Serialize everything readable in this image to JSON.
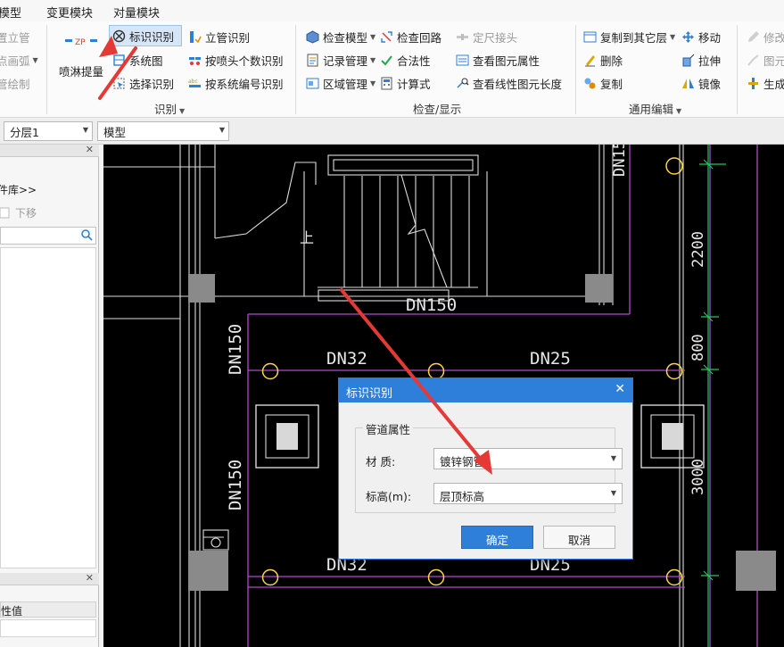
{
  "menubar": {
    "items": [
      "模型",
      "变更模块",
      "对量模块"
    ]
  },
  "ribbon": {
    "left_partial": [
      "置立管",
      "点画弧",
      "管绘制"
    ],
    "sprinkler_button": "喷淋提量",
    "sprinkler_icon_text": "ZP",
    "recognize": {
      "mark_recognize": "标识识别",
      "riser_recognize": "立管识别",
      "system_diagram": "系统图",
      "by_sprinkler_count": "按喷头个数识别",
      "select_recognize": "选择识别",
      "by_system_number": "按系统编号识别",
      "group_label": "识别"
    },
    "check": {
      "check_model": "检查模型",
      "check_loop": "检查回路",
      "set_size_joint": "定尺接头",
      "record_manage": "记录管理",
      "legality": "合法性",
      "view_element_props": "查看图元属性",
      "region_manage": "区域管理",
      "formula": "计算式",
      "view_linear_length": "查看线性图元长度",
      "group_label": "检查/显示"
    },
    "edit": {
      "copy_to_other_layer": "复制到其它层",
      "move": "移动",
      "delete": "删除",
      "stretch": "拉伸",
      "copy": "复制",
      "mirror": "镜像",
      "group_label": "通用编辑"
    },
    "right_partial": [
      "修改",
      "图元",
      "生成"
    ]
  },
  "toolbar2": {
    "layer_value": "分层1",
    "view_value": "模型"
  },
  "leftpanel": {
    "library_label": "件库>>",
    "move_down": "下移",
    "prop_value_header": "性值"
  },
  "cad": {
    "labels": [
      "DN150",
      "DN32",
      "DN25",
      "DN150",
      "DN150",
      "DN32",
      "DN25",
      "2200",
      "800",
      "3000",
      "DN15",
      "上"
    ]
  },
  "dialog": {
    "title": "标识识别",
    "group_title": "管道属性",
    "material_label": "材 质:",
    "material_value": "镀锌钢管",
    "elevation_label": "标高(m):",
    "elevation_value": "层顶标高",
    "ok": "确定",
    "cancel": "取消"
  },
  "colors": {
    "accent": "#2d7fd9",
    "annotation_red": "#e53935",
    "cad_purple": "#b34bc9",
    "cad_green": "#22c55e",
    "cad_yellow": "#ffd54a"
  }
}
